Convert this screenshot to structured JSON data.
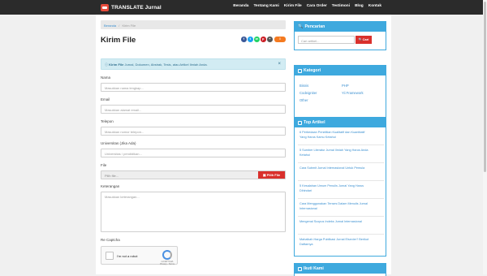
{
  "brand": "TRANSLATE Jurnal",
  "nav": [
    "Beranda",
    "Tentang Kami",
    "Kirim File",
    "Cara Order",
    "Testimoni",
    "Blog",
    "Kontak"
  ],
  "breadcrumb": {
    "home": "Beranda",
    "sep": "/",
    "current": "Kirim File"
  },
  "title": "Kirim File",
  "share": {
    "count": "0"
  },
  "alert": {
    "bold": "Kirim File",
    "text": " Jurnal, Dokumen, Abstrak, Tesis, atau Artikel Ilmiah Anda.",
    "close": "×"
  },
  "form": {
    "nama": {
      "label": "Nama",
      "placeholder": "Masukkan nama lengkap..."
    },
    "email": {
      "label": "Email",
      "placeholder": "Masukkan alamat email..."
    },
    "telepon": {
      "label": "Telepon",
      "placeholder": "Masukkan nomor telepon..."
    },
    "univ": {
      "label": "Universitas (Jika Ada)",
      "placeholder": "Universitas / pendidikan..."
    },
    "file": {
      "label": "File",
      "placeholder": "Pilih file...",
      "button": "Pilih File"
    },
    "ket": {
      "label": "Keterangan",
      "placeholder": "Masukkan keterangan..."
    },
    "captcha": {
      "label": "Re Captcha",
      "text": "I'm not a robot",
      "brand": "reCAPTCHA",
      "sub": "Privacy - Terms"
    }
  },
  "sidebar": {
    "search": {
      "title": "Pencarian",
      "placeholder": "Cari artikel...",
      "button": "Cari"
    },
    "kategori": {
      "title": "Kategori",
      "items": [
        "Bisnis",
        "PHP",
        "Codeigniter",
        "Yii Framework",
        "Other"
      ]
    },
    "top": {
      "title": "Top Artikel",
      "items": [
        "6 Perbedaan Penelitian Kualitatif dan Kuantitatif Yang Harus Kamu Ketahui",
        "5 Sumber Literatur Jurnal Ilmiah Yang Harus Anda Ketahui",
        "Cara Submit Jurnal Internasional Untuk Pemula",
        "5 Kesalahan Umum Penulis Jurnal Yang Harus Dihindari",
        "Cara Menggunakan Tenses Dalam Menulis Jurnal Internasional",
        "Mengenal Scopus Indeks Jurnal Internasional",
        "Mahalkah Harga Publikasi Jurnal Elsevier? Berikut Daftarnya"
      ]
    },
    "ikuti": {
      "title": "Ikuti Kami"
    }
  },
  "colors": {
    "accent": "#3ea9de",
    "danger": "#d9302c",
    "navbar": "#2b2b2b"
  }
}
